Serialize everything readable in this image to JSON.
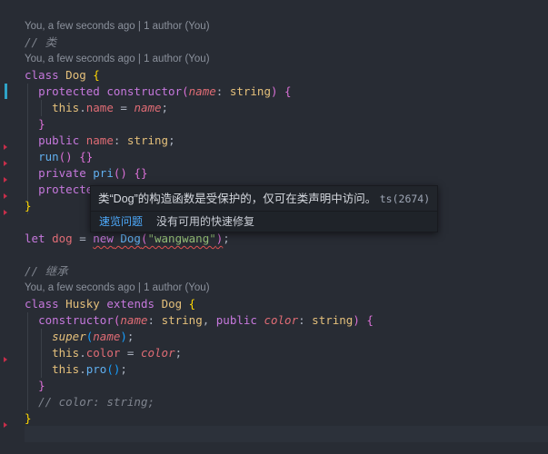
{
  "blame": {
    "line1": "You, a few seconds ago | 1 author (You)",
    "line2": "You, a few seconds ago | 1 author (You)",
    "line3": "You, a few seconds ago | 1 author (You)"
  },
  "code": {
    "comment_class": "// 类",
    "class_keyword": "class",
    "class_name": "Dog",
    "protected_kw": "protected",
    "constructor_kw": "constructor",
    "param_name": "name",
    "type_string": "string",
    "this_kw": "this",
    "prop_name": "name",
    "public_kw": "public",
    "run_fn": "run",
    "private_kw": "private",
    "pri_fn": "pri",
    "protected_trunc": "protecte",
    "let_kw": "let",
    "var_dog": "dog",
    "new_kw": "new",
    "dog_arg": "\"wangwang\"",
    "comment_inherit": "// 继承",
    "husky_name": "Husky",
    "extends_kw": "extends",
    "color_param": "color",
    "super_kw": "super",
    "color_prop": "color",
    "pro_fn": "pro",
    "comment_color": "// color: string;"
  },
  "hover": {
    "message": "类“Dog”的构造函数是受保护的，仅可在类声明中访问。",
    "code": "ts(2674)",
    "peek_problem": "速览问题",
    "no_quick_fix": "没有可用的快速修复"
  },
  "colors": {
    "background": "#282c34",
    "keyword": "#c678dd",
    "class": "#e5c07b",
    "function": "#61afef",
    "property": "#e06c75",
    "string": "#98c379",
    "comment": "#7f848e",
    "error_marker": "#c72e4a",
    "link": "#4daafc"
  }
}
